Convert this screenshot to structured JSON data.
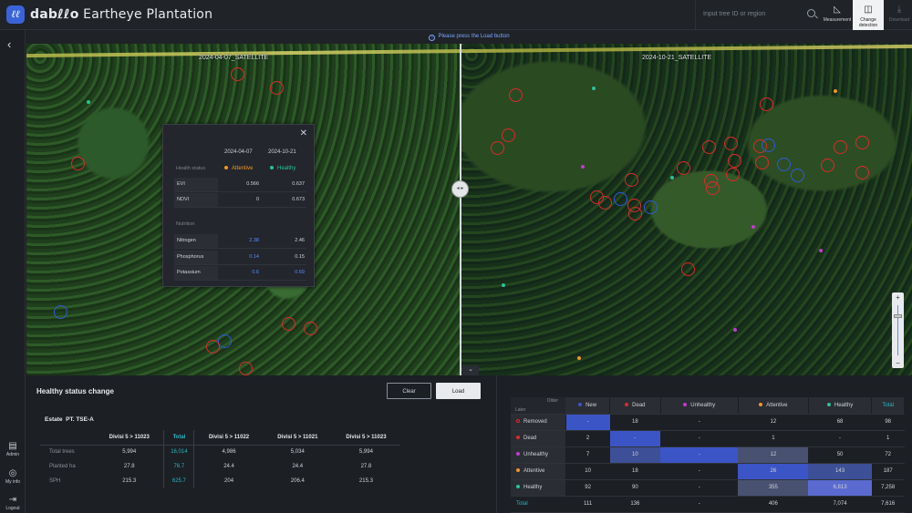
{
  "header": {
    "logo_text": "dab",
    "brand_name": "dabℓℓo",
    "brand_product": "Eartheye Plantation",
    "search_placeholder": "Input tree ID or region",
    "buttons": [
      {
        "label": "Measurement",
        "icon": "ruler-icon"
      },
      {
        "label": "Change detection",
        "icon": "split-icon"
      },
      {
        "label": "Download",
        "icon": "download-icon"
      }
    ]
  },
  "sidebar": {
    "items": [
      {
        "label": "Admin",
        "icon": "admin-icon"
      },
      {
        "label": "My info",
        "icon": "user-icon"
      },
      {
        "label": "Logout",
        "icon": "logout-icon"
      }
    ]
  },
  "map": {
    "notice": "Please press the Load button",
    "left_label": "2024-04-07_SATELLITE",
    "right_label": "2024-10-21_SATELLITE",
    "handle_label": "◂ ▸"
  },
  "popup": {
    "date1": "2024-04-07",
    "date2": "2024-10-21",
    "health_label": "Health status",
    "status1": "Attentive",
    "status2": "Healthy",
    "nutrition_label": "Nutrition",
    "rows": [
      {
        "k": "EVI",
        "v1": "0.566",
        "v2": "0.637"
      },
      {
        "k": "NDVI",
        "v1": "0",
        "v2": "0.673"
      }
    ],
    "nut_rows": [
      {
        "k": "Nitrogen",
        "v1": "2.38",
        "v2": "2.46"
      },
      {
        "k": "Phosphorus",
        "v1": "0.14",
        "v2": "0.15"
      },
      {
        "k": "Potassium",
        "v1": "0.6",
        "v2": "0.69"
      }
    ]
  },
  "summary": {
    "title": "Healthy status change",
    "clear": "Clear",
    "load": "Load",
    "estate_label": "Estate",
    "estate_value": "PT. TSE-A",
    "columns": [
      "Divisi 5 > 11023",
      "Total",
      "Divisi 5 > 11022",
      "Divisi 5 > 11021",
      "Divisi 5 > 11023"
    ],
    "rows": [
      {
        "k": "Total trees",
        "v": [
          "5,994",
          "16,014",
          "4,986",
          "5,034",
          "5,994"
        ]
      },
      {
        "k": "Planted ha",
        "v": [
          "27.8",
          "76.7",
          "24.4",
          "24.4",
          "27.8"
        ]
      },
      {
        "k": "SPH",
        "v": [
          "215.3",
          "625.7",
          "204",
          "206.4",
          "215.3"
        ]
      }
    ]
  },
  "matrix": {
    "older_label": "Older",
    "later_label": "Later",
    "columns": [
      "New",
      "Dead",
      "Unhealthy",
      "Attentive",
      "Healthy",
      "Total"
    ],
    "col_colors": [
      "#3b55c6",
      "#e0292b",
      "#c23bd0",
      "#f0952d",
      "#29c39a",
      ""
    ],
    "rows": [
      {
        "k": "Removed",
        "color": "#e0292b",
        "v": [
          "-",
          "18",
          "-",
          "12",
          "68",
          "98"
        ]
      },
      {
        "k": "Dead",
        "color": "#e0292b",
        "v": [
          "2",
          "-",
          "-",
          "1",
          "-",
          "1"
        ]
      },
      {
        "k": "Unhealthy",
        "color": "#c23bd0",
        "v": [
          "7",
          "10",
          "-",
          "12",
          "50",
          "72"
        ]
      },
      {
        "k": "Attentive",
        "color": "#f0952d",
        "v": [
          "10",
          "18",
          "-",
          "26",
          "143",
          "187"
        ]
      },
      {
        "k": "Healthy",
        "color": "#29c39a",
        "v": [
          "92",
          "90",
          "-",
          "355",
          "6,813",
          "7,258"
        ]
      },
      {
        "k": "Total",
        "color": "",
        "v": [
          "111",
          "136",
          "-",
          "406",
          "7,074",
          "7,616"
        ]
      }
    ]
  }
}
